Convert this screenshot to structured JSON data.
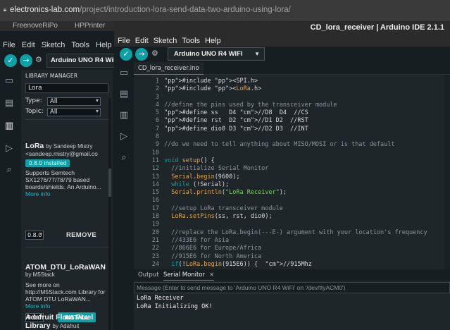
{
  "browser": {
    "url_domain": "electronics-lab.com",
    "url_path": "/project/introduction-lora-send-data-two-arduino-using-lora/",
    "bookmarks": [
      "FreenoveRiPo",
      "HPPrinter"
    ]
  },
  "back_ide": {
    "menu": [
      "File",
      "Edit",
      "Sketch",
      "Tools",
      "Help"
    ],
    "board": "Arduino UNO R4 WiFi",
    "library_manager": {
      "title": "LIBRARY MANAGER",
      "search_value": "Lora",
      "type_label": "Type:",
      "type_value": "All",
      "topic_label": "Topic:",
      "topic_value": "All",
      "libraries": [
        {
          "name": "LoRa",
          "author": "by Sandeep Mistry",
          "email": "<sandeep.mistry@gmail.co",
          "installed_badge": "0.8.0 installed",
          "description": [
            "Supports Semtech",
            "SX1276/77/78/79 based",
            "boards/shields. An Arduino..."
          ],
          "more_info": "More info",
          "version": "0.8.0",
          "action": "REMOVE"
        },
        {
          "name": "ATOM_DTU_LoRaWAN",
          "author": "by M5Stack",
          "description": [
            "See more on",
            "http://M5Stack.com Library for",
            "ATOM DTU LoRaWAN..."
          ],
          "more_info": "More info",
          "version": "0.0.1",
          "action": "INSTALL"
        },
        {
          "name_lines": [
            "Adafruit Flora Pixel",
            "Library"
          ],
          "author": "by Adafruit"
        }
      ]
    }
  },
  "ide": {
    "title": "CD_lora_receiver | Arduino IDE 2.1.1",
    "menu": [
      "File",
      "Edit",
      "Sketch",
      "Tools",
      "Help"
    ],
    "board": "Arduino UNO R4 WIFI",
    "file_tab": "CD_lora_receiver.ino",
    "code_lines": [
      "#include <SPI.h>",
      "#include <LoRa.h>",
      "",
      "//define the pins used by the transceiver module",
      "#define ss   D4 //D8  D4  //CS",
      "#define rst  D2 //D1 D2  //RST",
      "#define dio0 D3 //D2 D3  //INT",
      "",
      "//do we need to tell anything about MISO/MOSI or is that default",
      "",
      "void setup() {",
      "  //initialize Serial Monitor",
      "  Serial.begin(9600);",
      "  while (!Serial);",
      "  Serial.println(\"LoRa Receiver\");",
      "",
      "  //setup LoRa transceiver module",
      "  LoRa.setPins(ss, rst, dio0);",
      "",
      "  //replace the LoRa.begin(---E-) argument with your location's frequency",
      "  //433E6 for Asia",
      "  //866E6 for Europe/Africa",
      "  //915E6 for North America",
      "  if(!LoRa.begin(915E6)) {  //915Mhz"
    ],
    "output_tabs": {
      "output": "Output",
      "serial_monitor": "Serial Monitor",
      "close": "×"
    },
    "monitor_placeholder": "Message (Enter to send message to 'Arduino UNO R4 WiFi' on '/dev/ttyACM0')",
    "monitor_lines": [
      "LoRa Receiver",
      "LoRa Initializing OK!"
    ]
  },
  "colors": {
    "accent": "#0ca1a6",
    "editor_bg": "#1f2629",
    "toolbar_bg": "#171e21"
  },
  "icons": {
    "verify": "check-icon",
    "upload": "arrow-right-icon",
    "debug": "debug-icon",
    "folder": "folder-icon",
    "boards": "board-icon",
    "library": "library-icon",
    "search": "search-icon"
  }
}
